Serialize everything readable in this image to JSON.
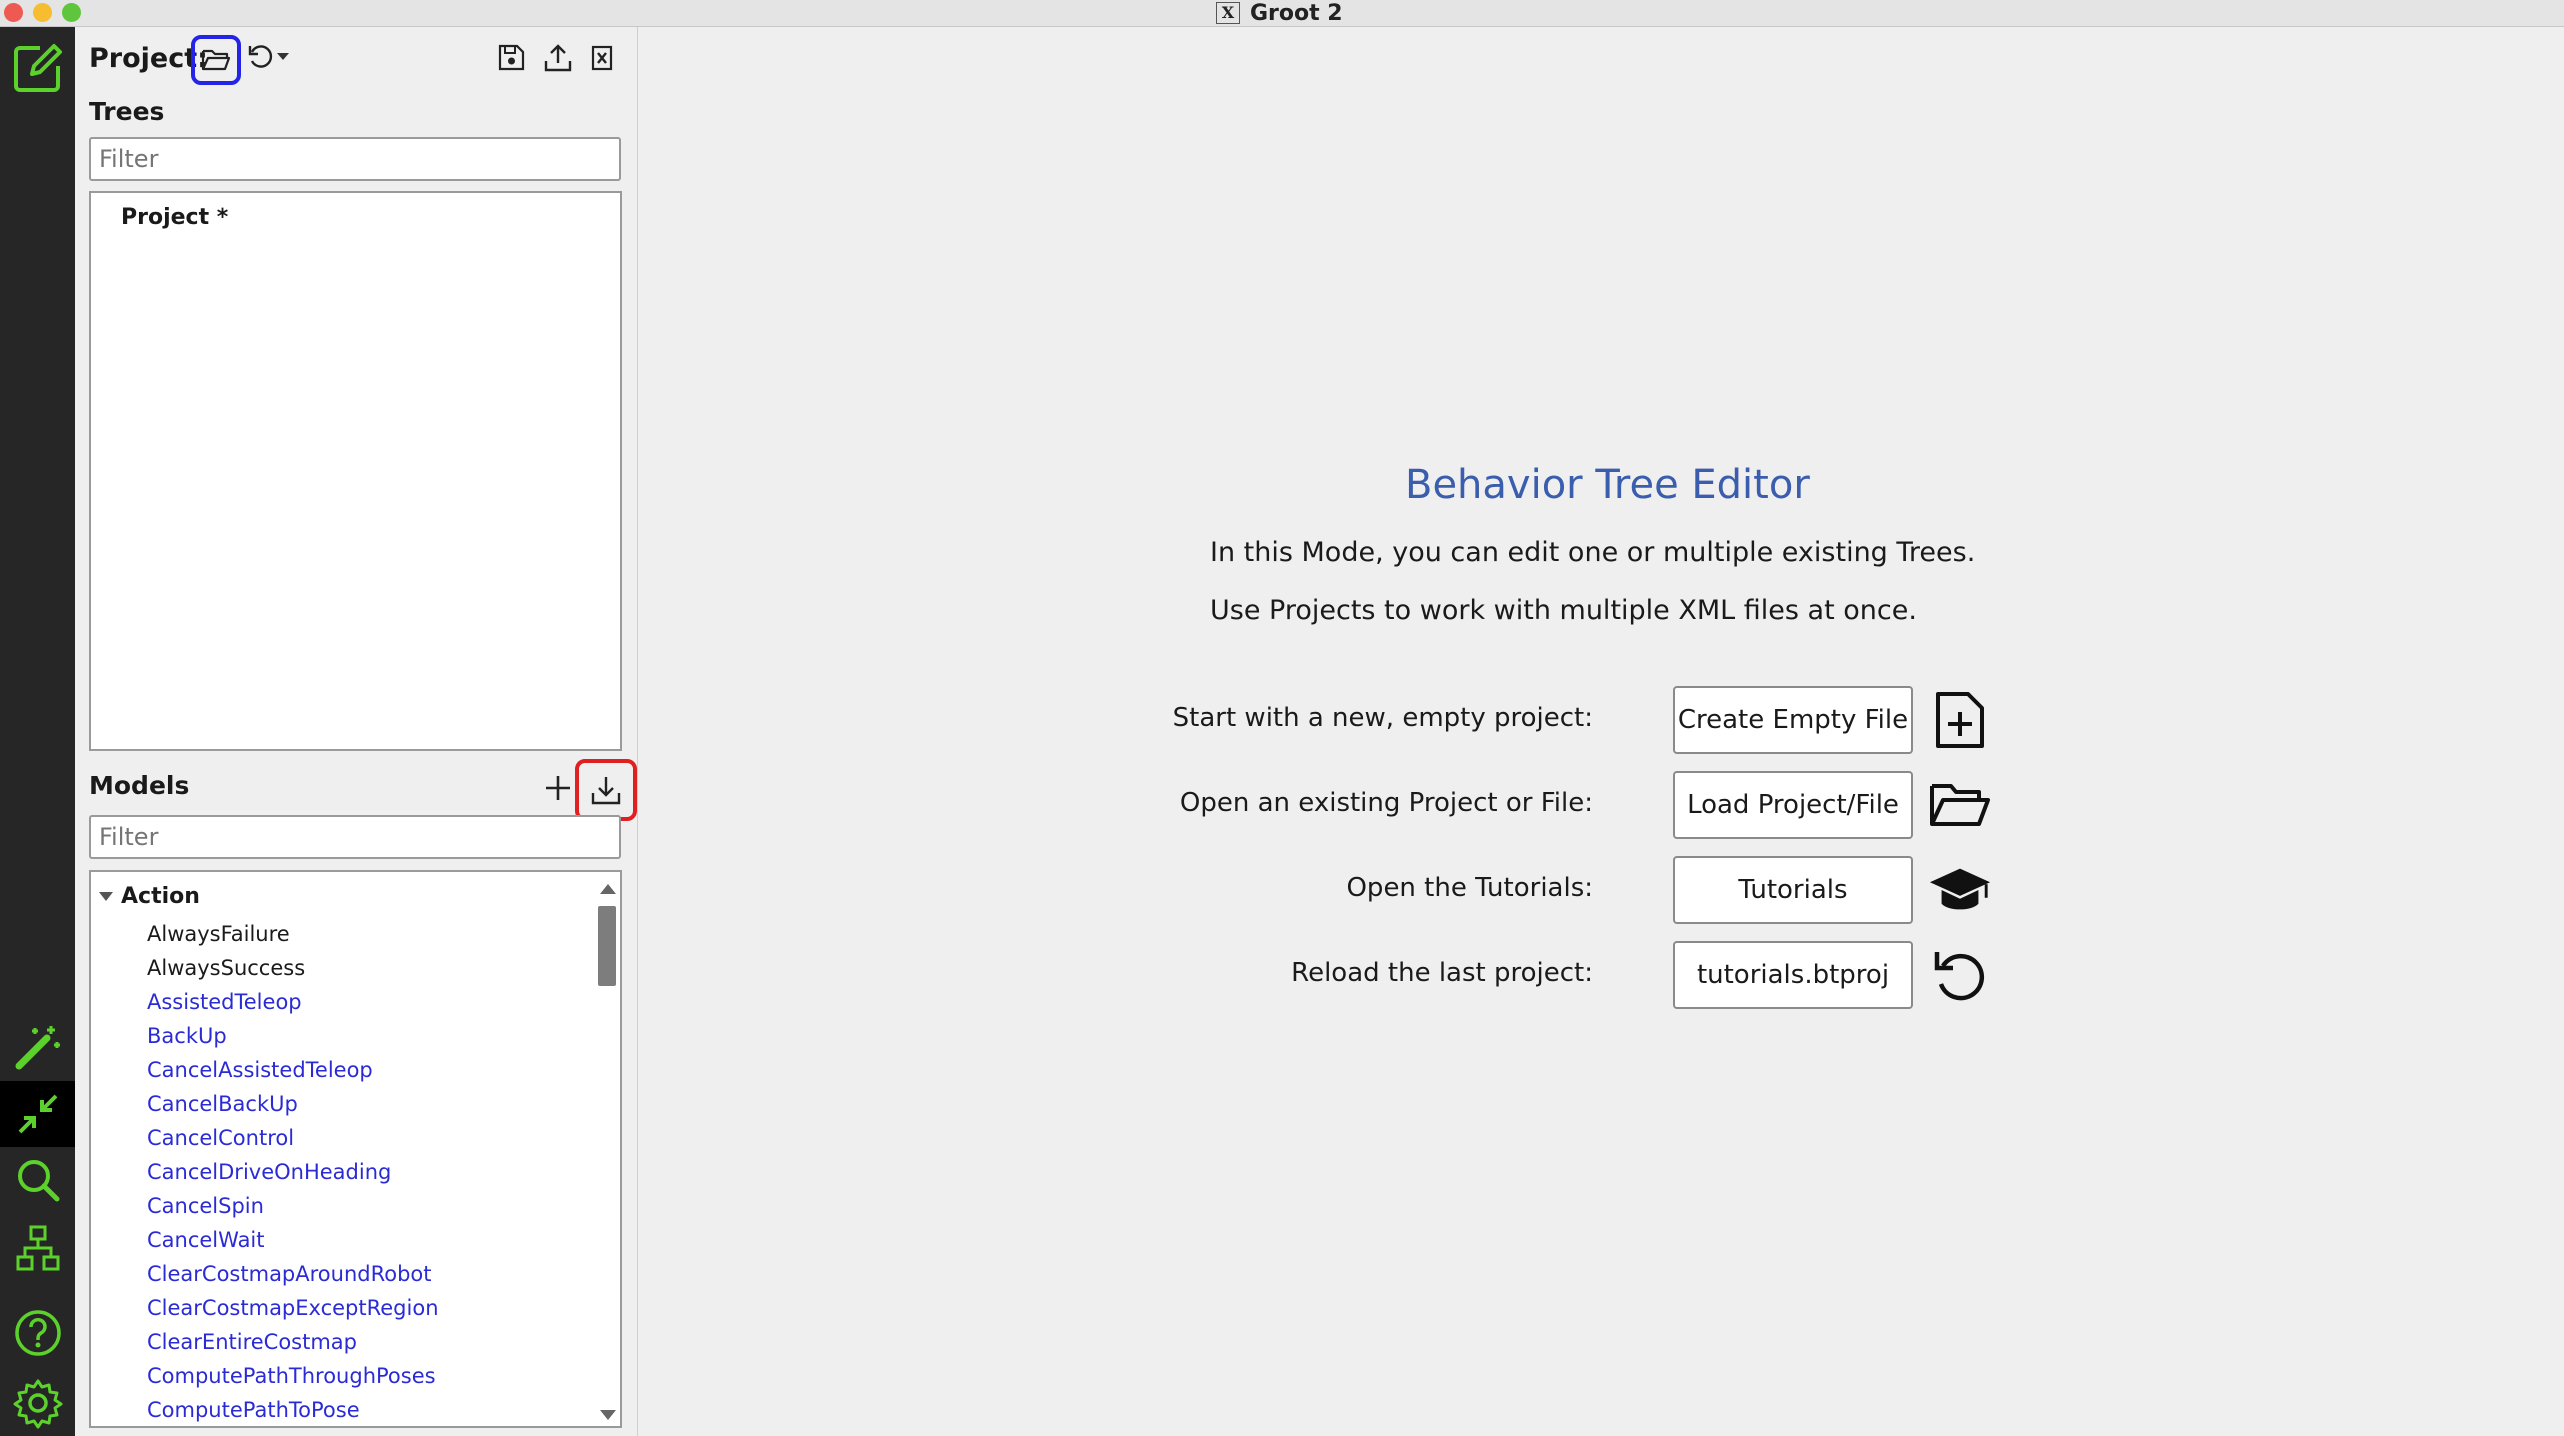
{
  "window": {
    "title": "Groot 2",
    "x_icon_text": "X"
  },
  "sidebar_modes": {
    "items": [
      {
        "name": "editor-mode",
        "icon": "edit-square-icon",
        "active": false
      },
      {
        "name": "wizard-mode",
        "icon": "magic-wand-icon",
        "active": false
      },
      {
        "name": "compact-mode",
        "icon": "collapse-arrows-icon",
        "active": true
      },
      {
        "name": "search-mode",
        "icon": "search-icon",
        "active": false
      },
      {
        "name": "hierarchy-mode",
        "icon": "hierarchy-icon",
        "active": false
      },
      {
        "name": "help",
        "icon": "help-icon",
        "active": false
      },
      {
        "name": "settings",
        "icon": "gear-icon",
        "active": false
      }
    ],
    "accent_color": "#5cd12c"
  },
  "panel": {
    "project_label": "Project:",
    "trees_title": "Trees",
    "trees_filter_placeholder": "Filter",
    "tree_root": "Project *",
    "models_title": "Models",
    "models_filter_placeholder": "Filter",
    "category": "Action",
    "models": [
      {
        "label": "AlwaysFailure",
        "color": "#1a1a1a"
      },
      {
        "label": "AlwaysSuccess",
        "color": "#1a1a1a"
      },
      {
        "label": "AssistedTeleop",
        "color": "#2b2bd6"
      },
      {
        "label": "BackUp",
        "color": "#2b2bd6"
      },
      {
        "label": "CancelAssistedTeleop",
        "color": "#2b2bd6"
      },
      {
        "label": "CancelBackUp",
        "color": "#2b2bd6"
      },
      {
        "label": "CancelControl",
        "color": "#2b2bd6"
      },
      {
        "label": "CancelDriveOnHeading",
        "color": "#2b2bd6"
      },
      {
        "label": "CancelSpin",
        "color": "#2b2bd6"
      },
      {
        "label": "CancelWait",
        "color": "#2b2bd6"
      },
      {
        "label": "ClearCostmapAroundRobot",
        "color": "#2b2bd6"
      },
      {
        "label": "ClearCostmapExceptRegion",
        "color": "#2b2bd6"
      },
      {
        "label": "ClearEntireCostmap",
        "color": "#2b2bd6"
      },
      {
        "label": "ComputePathThroughPoses",
        "color": "#2b2bd6"
      },
      {
        "label": "ComputePathToPose",
        "color": "#2b2bd6"
      }
    ]
  },
  "main": {
    "headline": "Behavior Tree Editor",
    "line1": "In this Mode, you can edit one or multiple existing Trees.",
    "line2": "Use Projects to work with multiple XML files at once.",
    "rows": [
      {
        "label": "Start with a new, empty project:",
        "button": "Create Empty File",
        "icon": "new-file-icon"
      },
      {
        "label": "Open an existing Project or File:",
        "button": "Load Project/File",
        "icon": "open-folder-icon"
      },
      {
        "label": "Open the Tutorials:",
        "button": "Tutorials",
        "icon": "graduation-cap-icon"
      },
      {
        "label": "Reload the last project:",
        "button": "tutorials.btproj",
        "icon": "reload-icon"
      }
    ]
  }
}
